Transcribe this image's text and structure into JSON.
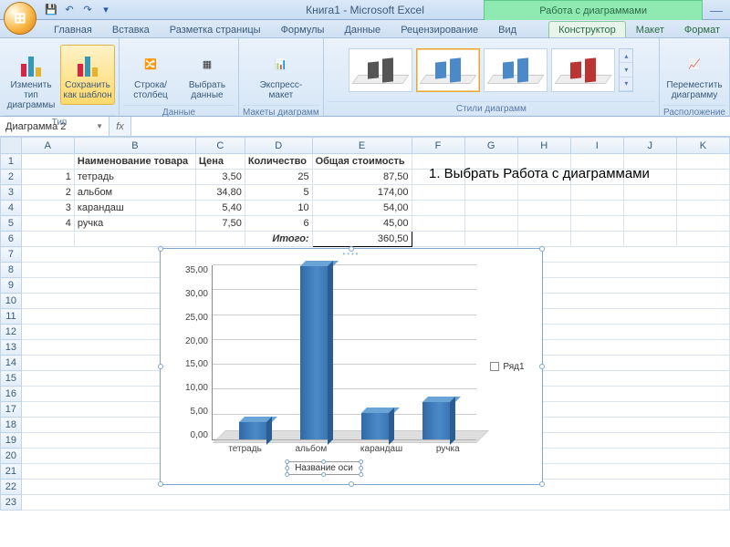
{
  "window": {
    "title": "Книга1 - Microsoft Excel",
    "chart_tools": "Работа с диаграммами"
  },
  "qat": {
    "save": "💾",
    "undo": "↶",
    "redo": "↷"
  },
  "tabs": {
    "main": [
      "Главная",
      "Вставка",
      "Разметка страницы",
      "Формулы",
      "Данные",
      "Рецензирование",
      "Вид"
    ],
    "chart": [
      "Конструктор",
      "Макет",
      "Формат"
    ],
    "active": "Конструктор"
  },
  "ribbon": {
    "group_type": "Тип",
    "change_type": "Изменить тип диаграммы",
    "save_template": "Сохранить как шаблон",
    "group_data": "Данные",
    "switch_rc": "Строка/столбец",
    "select_data": "Выбрать данные",
    "group_layouts": "Макеты диаграмм",
    "quick_layout": "Экспресс-макет",
    "group_styles": "Стили диаграмм",
    "group_location": "Расположение",
    "move_chart": "Переместить диаграмму"
  },
  "namebox": "Диаграмма 2",
  "sheet": {
    "cols": [
      "A",
      "B",
      "C",
      "D",
      "E",
      "F",
      "G",
      "H",
      "I",
      "J",
      "K"
    ],
    "headers": {
      "b": "Наименование товара",
      "c": "Цена",
      "d": "Количество",
      "e": "Общая стоимость"
    },
    "rows": [
      {
        "n": 1,
        "name": "тетрадь",
        "price": "3,50",
        "qty": 25,
        "sum": "87,50"
      },
      {
        "n": 2,
        "name": "альбом",
        "price": "34,80",
        "qty": 5,
        "sum": "174,00"
      },
      {
        "n": 3,
        "name": "карандаш",
        "price": "5,40",
        "qty": 10,
        "sum": "54,00"
      },
      {
        "n": 4,
        "name": "ручка",
        "price": "7,50",
        "qty": 6,
        "sum": "45,00"
      }
    ],
    "total_label": "Итого:",
    "total": "360,50"
  },
  "annotation": "1. Выбрать Работа с диаграммами",
  "chart": {
    "legend": "Ряд1",
    "axis_title": "Название оси",
    "yticks": [
      "35,00",
      "30,00",
      "25,00",
      "20,00",
      "15,00",
      "10,00",
      "5,00",
      "0,00"
    ]
  },
  "chart_data": {
    "type": "bar",
    "categories": [
      "тетрадь",
      "альбом",
      "карандаш",
      "ручка"
    ],
    "values": [
      3.5,
      34.8,
      5.4,
      7.5
    ],
    "series": [
      {
        "name": "Ряд1",
        "values": [
          3.5,
          34.8,
          5.4,
          7.5
        ]
      }
    ],
    "title": "",
    "xlabel": "Название оси",
    "ylabel": "",
    "ylim": [
      0,
      35
    ]
  }
}
